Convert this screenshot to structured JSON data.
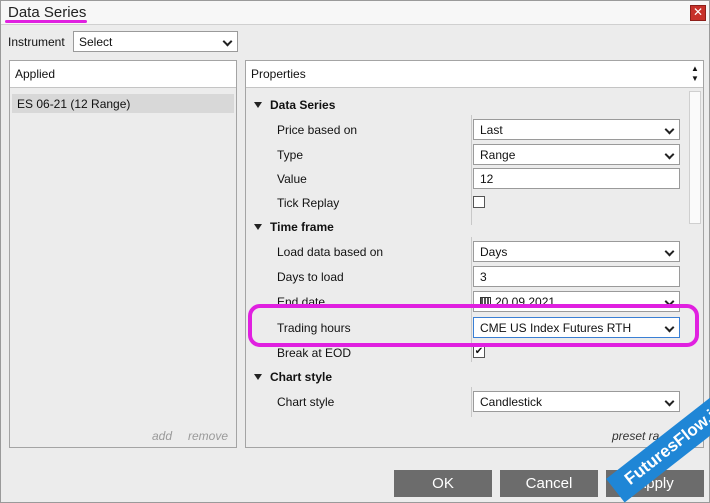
{
  "window": {
    "title": "Data Series",
    "close_glyph": "✕"
  },
  "instrument": {
    "label": "Instrument",
    "value": "Select"
  },
  "applied": {
    "header": "Applied",
    "items": [
      "ES 06-21 (12 Range)"
    ],
    "add_label": "add",
    "remove_label": "remove"
  },
  "properties": {
    "header": "Properties",
    "categories": {
      "data_series": "Data Series",
      "time_frame": "Time frame",
      "chart_style": "Chart style"
    },
    "rows": {
      "price_based_on": {
        "label": "Price based on",
        "value": "Last"
      },
      "type": {
        "label": "Type",
        "value": "Range"
      },
      "value": {
        "label": "Value",
        "value": "12"
      },
      "tick_replay": {
        "label": "Tick Replay",
        "checked": false
      },
      "load_data_based_on": {
        "label": "Load data based on",
        "value": "Days"
      },
      "days_to_load": {
        "label": "Days to load",
        "value": "3"
      },
      "end_date": {
        "label": "End date",
        "value": "20.09.2021"
      },
      "trading_hours": {
        "label": "Trading hours",
        "value": "CME US Index Futures RTH"
      },
      "break_at_eod": {
        "label": "Break at EOD",
        "checked": true
      },
      "chart_style": {
        "label": "Chart style",
        "value": "Candlestick"
      }
    },
    "preset_label": "preset ra"
  },
  "buttons": {
    "ok": "OK",
    "cancel": "Cancel",
    "apply": "Apply"
  },
  "watermark": "FuturesFlow.io",
  "colors": {
    "highlight": "#e020e0",
    "watermark": "#1f86d6",
    "button": "#6c6c6c"
  }
}
